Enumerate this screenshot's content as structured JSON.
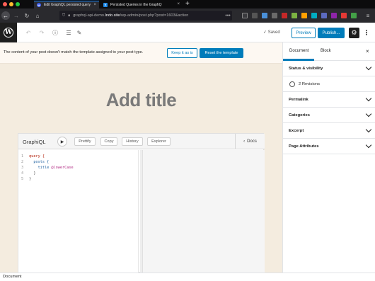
{
  "browser": {
    "tabs": [
      {
        "title": "Edit GraphQL persisted query"
      },
      {
        "title": "Persisted Queries in the GraphQ"
      }
    ],
    "url": {
      "prefix": "graphql-api-demo.",
      "host": "lndo.site",
      "path": "/wp-admin/post.php?post=1603&action"
    }
  },
  "toolbar": {
    "saved_label": "Saved",
    "preview_label": "Preview",
    "publish_label": "Publish..."
  },
  "notice": {
    "text": "The content of your post doesn't match the template assigned to your post type.",
    "keep_label": "Keep it as is",
    "reset_label": "Reset the template"
  },
  "post": {
    "title_placeholder": "Add title"
  },
  "graphiql": {
    "title": "GraphiQL",
    "buttons": [
      "Prettify",
      "Copy",
      "History",
      "Explorer"
    ],
    "docs_label": "Docs",
    "lines": [
      {
        "num": "1",
        "code": "query {"
      },
      {
        "num": "2",
        "code": "  posts {"
      },
      {
        "num": "3",
        "code": "    title @lowerCase"
      },
      {
        "num": "4",
        "code": "  }"
      },
      {
        "num": "5",
        "code": "}"
      }
    ]
  },
  "sidebar": {
    "tabs": [
      "Document",
      "Block"
    ],
    "panels": [
      "Status & visibility",
      "Permalink",
      "Categories",
      "Excerpt",
      "Page Attributes"
    ],
    "revisions": "2 Revisions"
  },
  "footer": {
    "breadcrumb": "Document"
  },
  "colors": {
    "accent": "#007cba",
    "canvas": "#f4ecdf",
    "dark": "#1e1e1e"
  }
}
